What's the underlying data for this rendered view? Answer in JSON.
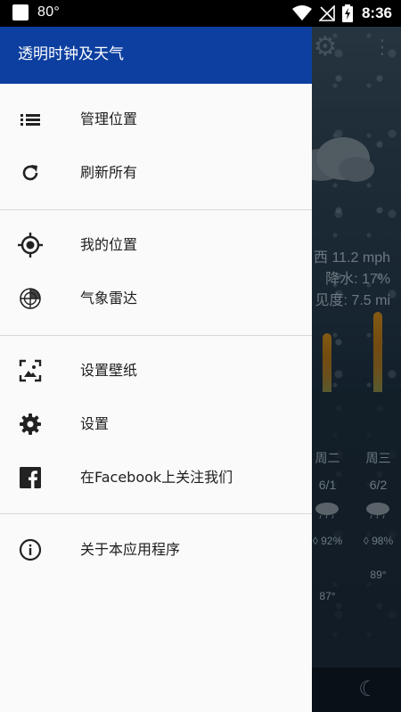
{
  "status_bar": {
    "temperature": "80°",
    "time": "8:36"
  },
  "drawer": {
    "title": "透明时钟及天气",
    "sections": [
      {
        "items": [
          {
            "label": "管理位置",
            "icon": "list-icon"
          },
          {
            "label": "刷新所有",
            "icon": "refresh-icon"
          }
        ]
      },
      {
        "items": [
          {
            "label": "我的位置",
            "icon": "gps-target-icon"
          },
          {
            "label": "气象雷达",
            "icon": "radar-icon"
          }
        ]
      },
      {
        "items": [
          {
            "label": "设置壁纸",
            "icon": "wallpaper-icon"
          },
          {
            "label": "设置",
            "icon": "gear-icon"
          },
          {
            "label": "在Facebook上关注我们",
            "icon": "facebook-icon"
          }
        ]
      },
      {
        "items": [
          {
            "label": "关于本应用程序",
            "icon": "info-icon"
          }
        ]
      }
    ]
  },
  "background_app": {
    "details": {
      "wind": "西 11.2 mph",
      "precipitation": "降水: 17%",
      "visibility": "见度: 7.5 mi"
    },
    "forecast": [
      {
        "day": "周二",
        "date": "6/1",
        "precip": "92%",
        "high": "87°",
        "bar_level": 0.7
      },
      {
        "day": "周三",
        "date": "6/2",
        "precip": "98%",
        "high": "89°",
        "bar_level": 0.9
      }
    ]
  },
  "colors": {
    "header": "#0d3fa0",
    "drawer_bg": "#fafafa",
    "status_bar": "#000000"
  }
}
